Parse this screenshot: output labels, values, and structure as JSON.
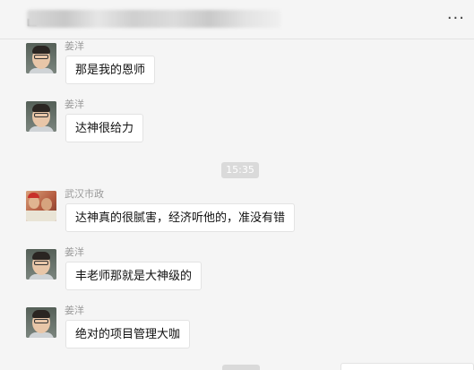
{
  "header": {
    "title": "",
    "more_icon": "more-dots-icon"
  },
  "time_divider": "15:35",
  "messages": [
    {
      "sender": "姜洋",
      "text": "那是我的恩师",
      "avatar": "avatar-jiangyang"
    },
    {
      "sender": "姜洋",
      "text": "达神很给力",
      "avatar": "avatar-jiangyang"
    },
    {
      "sender": "武汉市政",
      "text": "达神真的很腻害，经济听他的，准没有错",
      "avatar": "avatar-wuhanshizheng"
    },
    {
      "sender": "姜洋",
      "text": "丰老师那就是大神级的",
      "avatar": "avatar-jiangyang"
    },
    {
      "sender": "姜洋",
      "text": "绝对的项目管理大咖",
      "avatar": "avatar-jiangyang"
    }
  ]
}
